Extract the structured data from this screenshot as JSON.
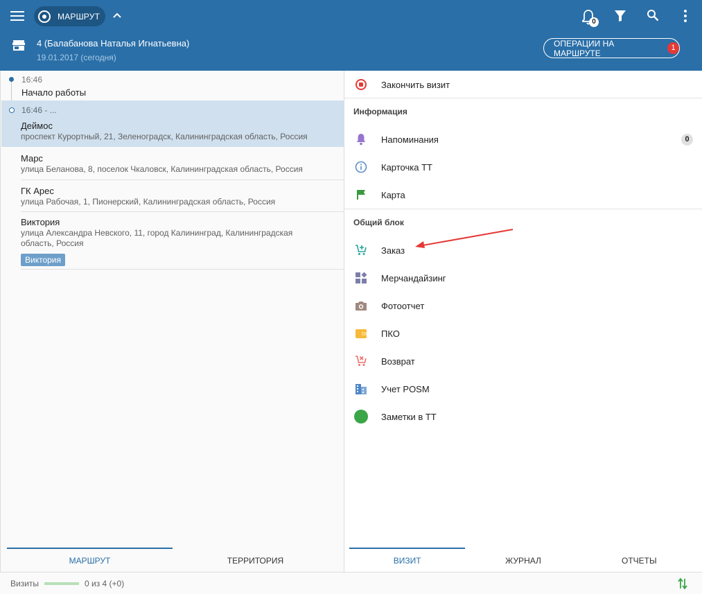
{
  "header": {
    "route_chip_label": "МАРШРУТ",
    "bell_count": "0",
    "client_name": "4 (Балабанова Наталья Игнатьевна)",
    "client_date": "19.01.2017 (сегодня)",
    "ops_button_label": "ОПЕРАЦИИ НА МАРШРУТЕ",
    "ops_badge": "1"
  },
  "route": {
    "start": {
      "time": "16:46",
      "title": "Начало работы"
    },
    "selected": {
      "time": "16:46 - ...",
      "title": "Деймос",
      "address": "проспект Курортный, 21, Зеленоградск, Калининградская область, Россия"
    },
    "items": [
      {
        "title": "Марс",
        "address": "улица Беланова, 8, поселок Чкаловск, Калининградская область, Россия"
      },
      {
        "title": "ГК Арес",
        "address": "улица Рабочая, 1, Пионерский, Калининградская область, Россия"
      },
      {
        "title": "Виктория",
        "address_line1": "улица Александра Невского, 11, город Калининград, Калининградская",
        "address_line2": "область, Россия",
        "tag": "Виктория"
      }
    ]
  },
  "left_tabs": [
    "МАРШРУТ",
    "ТЕРРИТОРИЯ"
  ],
  "visit_menu": {
    "finish_visit": "Закончить визит",
    "section_info": "Информация",
    "reminders": "Напоминания",
    "reminders_count": "0",
    "tt_card": "Карточка ТТ",
    "map": "Карта",
    "section_common": "Общий блок",
    "order": "Заказ",
    "merchandising": "Мерчандайзинг",
    "photo_report": "Фотоотчет",
    "pko": "ПКО",
    "return": "Возврат",
    "posm": "Учет POSM",
    "notes": "Заметки в ТТ"
  },
  "right_tabs": [
    "ВИЗИТ",
    "ЖУРНАЛ",
    "ОТЧЕТЫ"
  ],
  "footer": {
    "visits_label": "Визиты",
    "visits_progress": 0,
    "visits_count": "0 из 4 (+0)"
  },
  "colors": {
    "primary": "#2a6fa8",
    "selected_row": "#d0e0ee",
    "badge_red": "#e53935",
    "annotation_arrow": "#e53935"
  }
}
